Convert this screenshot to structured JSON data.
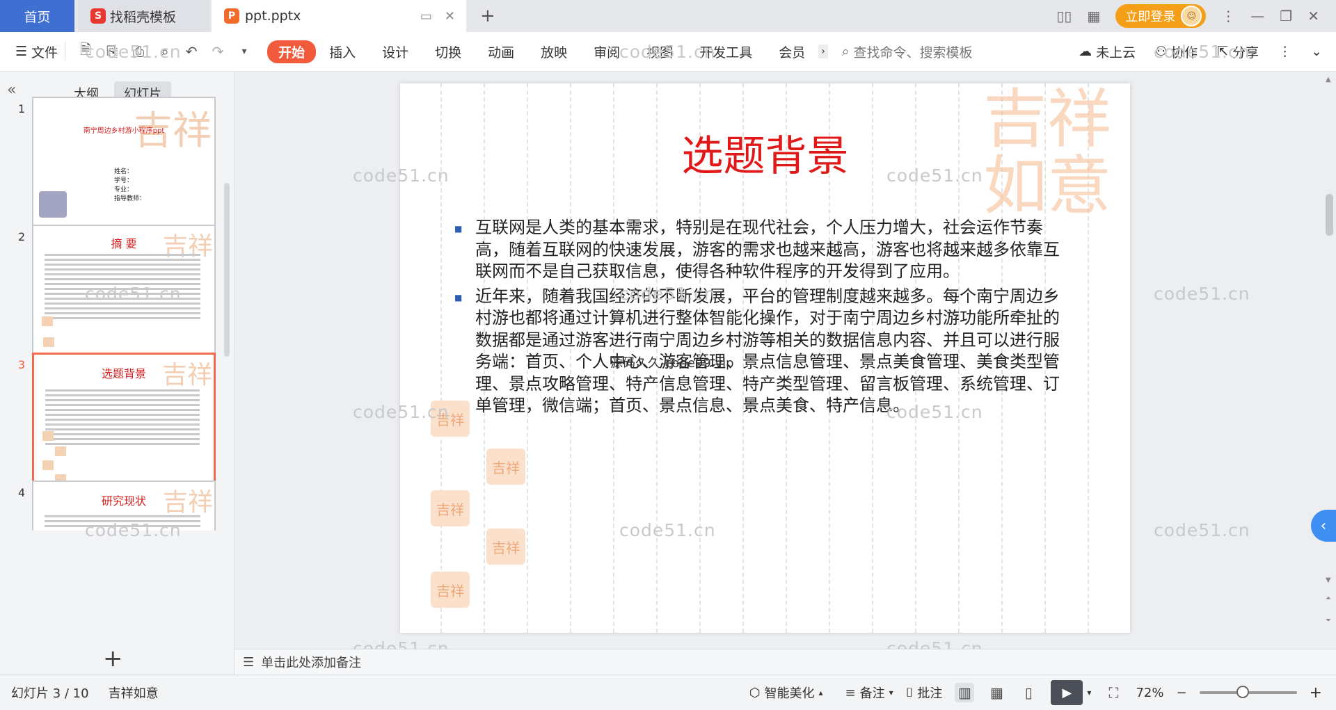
{
  "tabs": {
    "home": "首页",
    "templates": "找稻壳模板",
    "document": "ppt.pptx",
    "new_tab": "+"
  },
  "titlebar": {
    "login": "立即登录"
  },
  "ribbon": {
    "file_menu": "文件",
    "tabs": [
      "开始",
      "插入",
      "设计",
      "切换",
      "动画",
      "放映",
      "审阅",
      "视图",
      "开发工具",
      "会员"
    ],
    "active_tab": "开始",
    "search_placeholder": "查找命令、搜索模板",
    "cloud": "未上云",
    "collab": "协作",
    "share": "分享"
  },
  "left_panel": {
    "tab_outline": "大纲",
    "tab_slides": "幻灯片",
    "active": "幻灯片",
    "thumbnails": [
      {
        "num": "1",
        "title": "南宁周边乡村游小程序ppt",
        "meta": [
          "姓名：",
          "学号：",
          "专业：",
          "指导教师："
        ]
      },
      {
        "num": "2",
        "title": "摘  要"
      },
      {
        "num": "3",
        "title": "选题背景"
      },
      {
        "num": "4",
        "title": "研究现状"
      }
    ],
    "current": 3
  },
  "slide": {
    "title": "选题背景",
    "bullets": [
      "互联网是人类的基本需求，特别是在现代社会，个人压力增大，社会运作节奏高，随着互联网的快速发展，游客的需求也越来越高，游客也将越来越多依靠互联网而不是自己获取信息，使得各种软件程序的开发得到了应用。",
      "近年来，随着我国经济的不断发展，平台的管理制度越来越多。每个南宁周边乡村游也都将通过计算机进行整体智能化操作，对于南宁周边乡村游功能所牵扯的数据都是通过游客进行南宁周边乡村游等相关的数据信息内容、并且可以进行服务端：首页、个人中心、游客管理、景点信息管理、景点美食管理、美食类型管理、景点攻略管理、特产信息管理、特产类型管理、留言板管理、系统管理、订单管理，微信端；首页、景点信息、景点美食、特产信息。"
    ],
    "overlay": "源码久久-code99.vip"
  },
  "watermark": "code51.cn",
  "notes_placeholder": "单击此处添加备注",
  "status": {
    "slide_counter": "幻灯片 3 / 10",
    "theme": "吉祥如意",
    "smart": "智能美化",
    "notes": "备注",
    "comment": "批注",
    "zoom": "72%"
  },
  "zoom_level": 0.72,
  "colors": {
    "accent": "#f25a3c",
    "home_tab": "#3f6fd1",
    "title_red": "#e01818",
    "login": "#f59f18"
  }
}
